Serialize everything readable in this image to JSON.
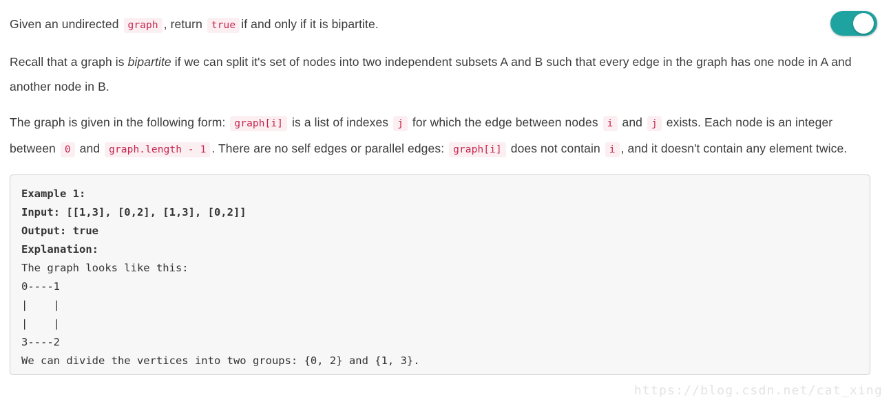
{
  "toggle": {
    "name": "theme-toggle",
    "state": "on",
    "on_color": "#1fa3a0",
    "knob_color": "#ffffff"
  },
  "paragraphs": {
    "p1": {
      "s1": "Given an undirected",
      "c1": "graph",
      "s2": ", return",
      "c2": "true",
      "s3": "if and only if it is bipartite."
    },
    "p2": {
      "s1": "Recall that a graph is",
      "em1": "bipartite",
      "s2": "if we can split it's set of nodes into two independent subsets A and B such that every edge in the graph has one node in A and another node in B."
    },
    "p3": {
      "s1": "The graph is given in the following form:",
      "c1": "graph[i]",
      "s2": "is a list of indexes",
      "c2": "j",
      "s3": "for which the edge between nodes",
      "c3": "i",
      "s4": "and",
      "c4": "j",
      "s5": "exists.  Each node is an integer between",
      "c5": "0",
      "s6": "and",
      "c6": "graph.length - 1",
      "s7": ".  There are no self edges or parallel edges:",
      "c7": "graph[i]",
      "s8": "does not contain",
      "c8": "i",
      "s9": ", and it doesn't contain any element twice."
    }
  },
  "codeblock": {
    "header_lines": "Example 1:\nInput: [[1,3], [0,2], [1,3], [0,2]]\nOutput: true\nExplanation:",
    "body_lines": "The graph looks like this:\n0----1\n|    |\n|    |\n3----2\nWe can divide the vertices into two groups: {0, 2} and {1, 3}.",
    "bg_color": "#f7f7f7",
    "border_color": "#cfcfcf"
  },
  "watermark": {
    "text": "https://blog.csdn.net/cat_xing",
    "color": "#e3e3e3"
  },
  "theme": {
    "inline_code_color": "#c7254e",
    "inline_code_bg": "#fbeff2",
    "text_color": "#3b3b3b"
  }
}
